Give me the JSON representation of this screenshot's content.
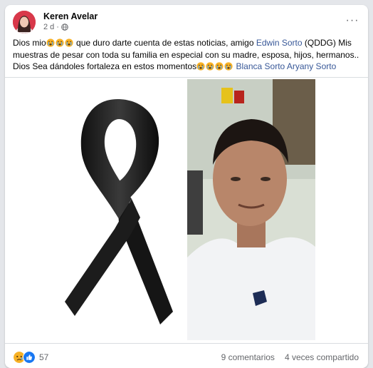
{
  "post": {
    "author": "Keren Avelar",
    "time": "2 d",
    "separator": "·",
    "more_label": "···",
    "text": {
      "p1": "Dios mio",
      "p2": " que duro darte cuenta de estas noticias, amigo ",
      "mention1": "Edwin Sorto",
      "p3": "  (QDDG) Mis muestras de pesar  con toda su familia en especial con su madre, esposa, hijos, hermanos.. Dios Sea dándoles fortaleza en estos momentos",
      "mention2": "Blanca Sorto Aryany Sorto"
    },
    "emoji": "crying-face",
    "reaction_count": "57",
    "comments": "9 comentarios",
    "shares": "4 veces compartido"
  },
  "colors": {
    "mention": "#385898",
    "secondary_text": "#65676b",
    "like_blue": "#1877f2",
    "sad_yellow": "#f7b125"
  }
}
